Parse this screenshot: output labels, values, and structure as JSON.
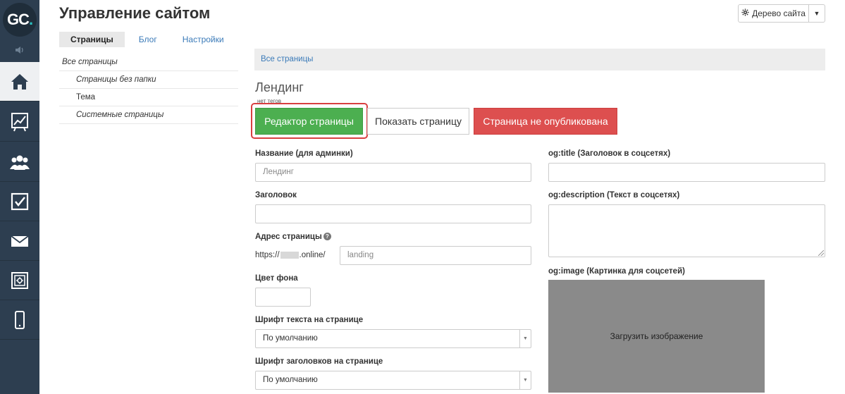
{
  "logo": {
    "text": "GC",
    "dot": "."
  },
  "header": {
    "title": "Управление сайтом",
    "tree_button": "Дерево сайта"
  },
  "tabs": [
    {
      "label": "Страницы"
    },
    {
      "label": "Блог"
    },
    {
      "label": "Настройки"
    }
  ],
  "sidebar": {
    "items": [
      {
        "label": "Все страницы"
      },
      {
        "label": "Страницы без папки"
      },
      {
        "label": "Тема"
      },
      {
        "label": "Системные страницы"
      }
    ]
  },
  "breadcrumb": "Все страницы",
  "page": {
    "title": "Лендинг",
    "tags": "нет тегов"
  },
  "actions": {
    "edit": "Редактор страницы",
    "show": "Показать страницу",
    "unpublished": "Страница не опубликована"
  },
  "form": {
    "name_label": "Название (для админки)",
    "name_placeholder": "Лендинг",
    "heading_label": "Заголовок",
    "address_label": "Адрес страницы",
    "address_help": "?",
    "address_prefix_start": "https://",
    "address_prefix_end": ".online/",
    "address_placeholder": "landing",
    "bgcolor_label": "Цвет фона",
    "text_font_label": "Шрифт текста на странице",
    "text_font_value": "По умолчанию",
    "heading_font_label": "Шрифт заголовков на странице",
    "heading_font_value": "По умолчанию",
    "og_title_label": "og:title (Заголовок в соцсетях)",
    "og_description_label": "og:description (Текст в соцсетях)",
    "og_image_label": "og:image (Картинка для соцсетей)",
    "upload_label": "Загрузить изображение"
  },
  "colors": {
    "rail": "#2d3e50",
    "edit_button": "#4caf50",
    "unpublished_button": "#dd4f4f",
    "highlight": "#d94040",
    "link": "#3a7ab8"
  },
  "icons": {
    "rail": [
      "home-icon",
      "chart-icon",
      "users-icon",
      "checkbox-icon",
      "mail-icon",
      "safe-icon",
      "mobile-icon"
    ]
  }
}
